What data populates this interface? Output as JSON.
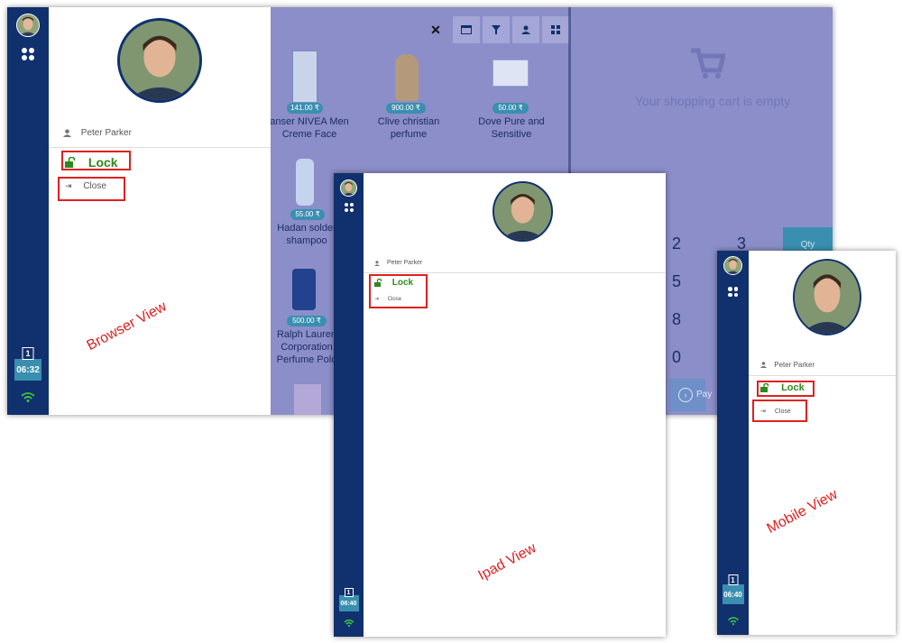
{
  "colors": {
    "sidebar": "#10306e",
    "lock_green": "#2f8a1c",
    "highlight_red": "#e02020",
    "pos_overlay": "#8b8ec8",
    "price_badge": "#3a8fb0"
  },
  "user": {
    "name": "Peter Parker"
  },
  "menu": {
    "lock_label": "Lock",
    "close_label": "Close"
  },
  "browser": {
    "label": "Browser View",
    "clock": {
      "num": "1",
      "time": "06:32"
    },
    "toolbar_icons": [
      "close-icon",
      "calendar-icon",
      "filter-icon",
      "user-icon",
      "grid-icon"
    ],
    "products": [
      {
        "name": "anser NIVEA Men Creme Face",
        "price": "141.00 ₹"
      },
      {
        "name": "Clive christian perfume",
        "price": "900.00 ₹"
      },
      {
        "name": "Dove Pure and Sensitive",
        "price": "50.00 ₹"
      },
      {
        "name": "Hadan solder shampoo",
        "price": "55.00 ₹"
      },
      {
        "name": "Ralph Lauren Corporation Perfume Polo",
        "price": "500.00 ₹"
      }
    ],
    "cart_empty": "Your shopping cart is empty",
    "numpad": [
      "2",
      "3",
      "5",
      "8",
      "0"
    ],
    "qty_label": "Qty",
    "pay_label": "Pay"
  },
  "ipad": {
    "label": "Ipad View",
    "clock": {
      "num": "1",
      "time": "06:40"
    }
  },
  "mobile": {
    "label": "Mobile View",
    "clock": {
      "num": "1",
      "time": "06:40"
    }
  }
}
